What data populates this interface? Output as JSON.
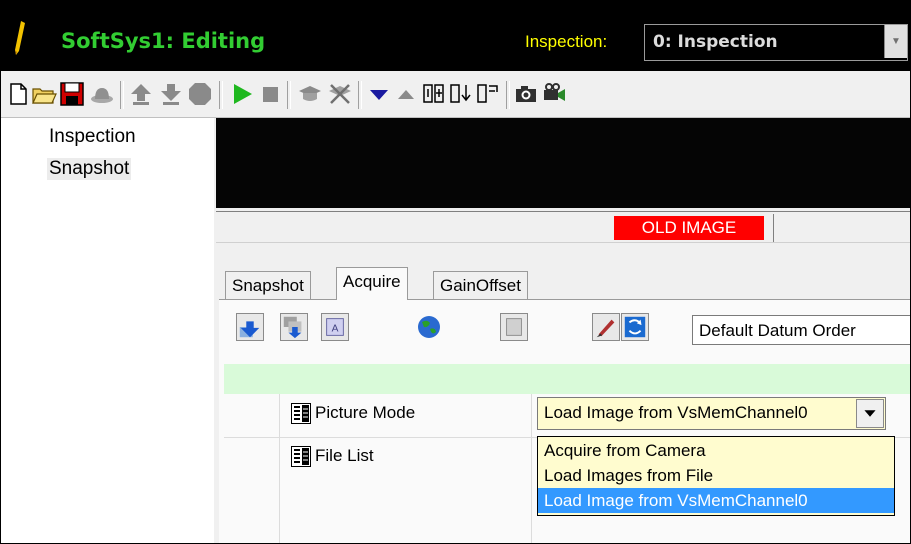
{
  "titlebar": {
    "app_title": "SoftSys1: Editing",
    "inspection_label": "Inspection:",
    "inspection_value": "0: Inspection"
  },
  "toolbar": {
    "icons": [
      "new-file-icon",
      "open-folder-icon",
      "save-icon",
      "hat-icon",
      "upload-icon",
      "download-icon",
      "stop-octagon-icon",
      "play-icon",
      "stop-square-icon",
      "student-hat-icon",
      "remove-icon",
      "triangle-down-icon",
      "triangle-up-icon",
      "columns-icon",
      "insert-icon",
      "export-icon",
      "camera-icon",
      "projector-icon"
    ]
  },
  "tree": {
    "items": [
      {
        "label": "Inspection",
        "selected": false
      },
      {
        "label": "Snapshot",
        "selected": true
      }
    ]
  },
  "viewer": {
    "status_badge": "OLD IMAGE"
  },
  "tabs": [
    {
      "label": "Snapshot",
      "active": false
    },
    {
      "label": "Acquire",
      "active": true
    },
    {
      "label": "GainOffset",
      "active": false
    }
  ],
  "panel": {
    "datum_order": "Default Datum Order",
    "properties": [
      {
        "label": "Picture Mode",
        "value": "Load Image from VsMemChannel0"
      },
      {
        "label": "File List",
        "value": ""
      }
    ],
    "picture_mode_options": [
      {
        "label": "Acquire from Camera",
        "selected": false
      },
      {
        "label": "Load Images from File",
        "selected": false
      },
      {
        "label": "Load Image from VsMemChannel0",
        "selected": true
      }
    ]
  },
  "colors": {
    "titlebar_bg": "#000000",
    "app_title": "#32cd32",
    "inspection_label": "#ffff00",
    "old_image_badge": "#ff0000",
    "selection": "#3399ff",
    "combo_bg": "#fffccf",
    "green_bar": "#d9fad9"
  }
}
